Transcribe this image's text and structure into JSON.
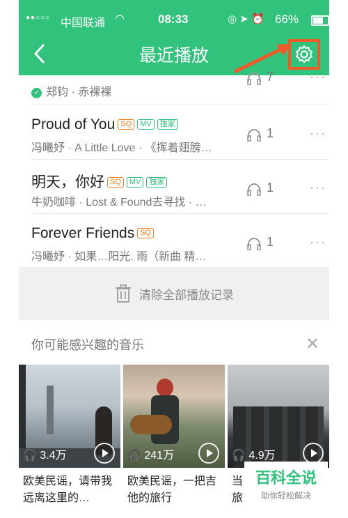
{
  "status_bar": {
    "signal": "●●○○○",
    "carrier": "中国联通",
    "wifi": "◠",
    "time": "08:33",
    "icons": "◎ ➤ ⏰",
    "battery": "66%"
  },
  "nav": {
    "title": "最近播放"
  },
  "songs": [
    {
      "name": "",
      "meta": "郑钧 · 赤裸裸",
      "count": "7"
    },
    {
      "name": "Proud of You",
      "tags": [
        "SQ",
        "MV",
        "独家"
      ],
      "meta": "冯曦妤 · A Little Love · 《挥着翅膀…",
      "count": "1"
    },
    {
      "name": "明天，你好",
      "tags": [
        "SQ",
        "MV",
        "独家"
      ],
      "meta": "牛奶咖啡 · Lost & Found去寻找 · …",
      "count": "1"
    },
    {
      "name": "Forever Friends",
      "tags": [
        "SQ"
      ],
      "meta": "冯曦妤 · 如果…阳光. 雨（新曲 精…",
      "count": "1"
    }
  ],
  "more_icon": "···",
  "clear_label": "清除全部播放记录",
  "suggest": {
    "label": "你可能感兴趣的音乐",
    "close": "✕"
  },
  "cards": [
    {
      "plays": "3.4万",
      "caption": "欧美民谣，请带我远离这里的…"
    },
    {
      "plays": "241万",
      "caption": "欧美民谣，一把吉他的旅行"
    },
    {
      "plays": "4.9万",
      "caption": "当… 遇上音乐，旅…"
    }
  ],
  "watermark": {
    "title": "百科全说",
    "subtitle": "助你轻松解决"
  },
  "colors": {
    "brand_green": "#31c27c",
    "highlight_orange": "#f05a28",
    "sq_orange": "#f08020"
  }
}
